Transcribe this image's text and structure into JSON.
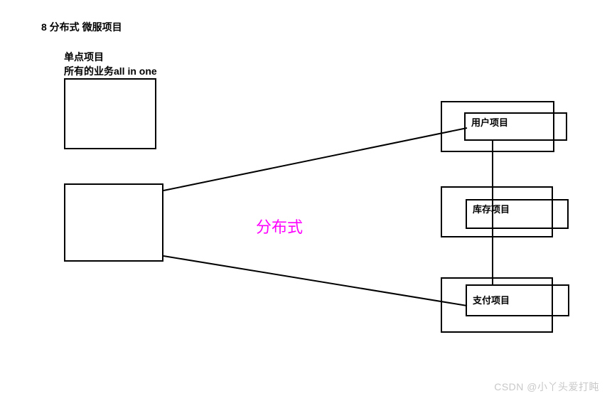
{
  "header": {
    "title": "8 分布式   微服项目",
    "subtitle_line1": "单点项目",
    "subtitle_line2": "所有的业务all in  one"
  },
  "center": {
    "label": "分布式"
  },
  "nodes": {
    "user": {
      "label": "用户项目"
    },
    "stock": {
      "label": "库存项目"
    },
    "payment": {
      "label": "支付项目"
    }
  },
  "watermark": "CSDN @小丫头爱打盹"
}
